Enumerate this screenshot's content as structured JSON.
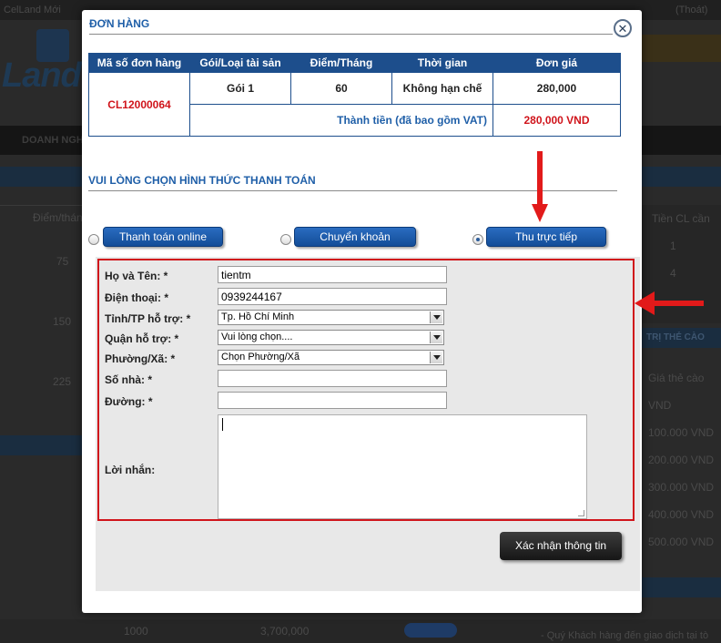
{
  "background": {
    "top_left": "CelLand Mới",
    "top_right": "(Thoát)",
    "logo": "Land",
    "nav_item": "DOANH NGHIỆP",
    "left_col_header": "Điểm/tháng",
    "left_values": [
      "75",
      "150",
      "225"
    ],
    "right_col_header": "Tiền CL cần",
    "right_values": [
      "1",
      "4"
    ],
    "right_section": "TRỊ THẺ CÀO",
    "right_sub": "Giá thẻ cào",
    "right_sub2": "VND",
    "right_prices": [
      "100.000 VND",
      "200.000 VND",
      "300.000 VND",
      "400.000 VND",
      "500.000 VND"
    ],
    "bottom_points": "1000",
    "bottom_price": "3,700,000",
    "bottom_note": "- Quý Khách hàng đến giao dịch tại tò"
  },
  "modal": {
    "title": "ĐƠN HÀNG",
    "close_icon": "close-icon",
    "order_table": {
      "headers": [
        "Mã số đơn hàng",
        "Gói/Loại tài sản",
        "Điểm/Tháng",
        "Thời gian",
        "Đơn giá"
      ],
      "order_code": "CL12000064",
      "row": [
        "Gói 1",
        "60",
        "Không hạn chế",
        "280,000"
      ],
      "total_label": "Thành tiền (đã bao gồm VAT)",
      "total_value": "280,000 VND"
    },
    "payment_title": "VUI LÒNG CHỌN HÌNH THỨC THANH TOÁN",
    "payment_options": [
      {
        "label": "Thanh toán online",
        "checked": false
      },
      {
        "label": "Chuyển khoản",
        "checked": false
      },
      {
        "label": "Thu trực tiếp",
        "checked": true
      }
    ],
    "form": {
      "name_label": "Họ và Tên: *",
      "name_value": "tientm",
      "phone_label": "Điện thoại: *",
      "phone_value": "0939244167",
      "province_label": "Tỉnh/TP hỗ trợ: *",
      "province_value": "Tp. Hồ Chí Minh",
      "district_label": "Quận hỗ trợ: *",
      "district_value": "Vui lòng chọn....",
      "ward_label": "Phường/Xã: *",
      "ward_value": "Chọn Phường/Xã",
      "house_label": "Số nhà: *",
      "house_value": "",
      "street_label": "Đường: *",
      "street_value": "",
      "message_label": "Lời nhắn:"
    },
    "confirm_button": "Xác nhận thông tin"
  },
  "colors": {
    "accent_blue": "#1d4e8c",
    "highlight_red": "#d0141b"
  }
}
